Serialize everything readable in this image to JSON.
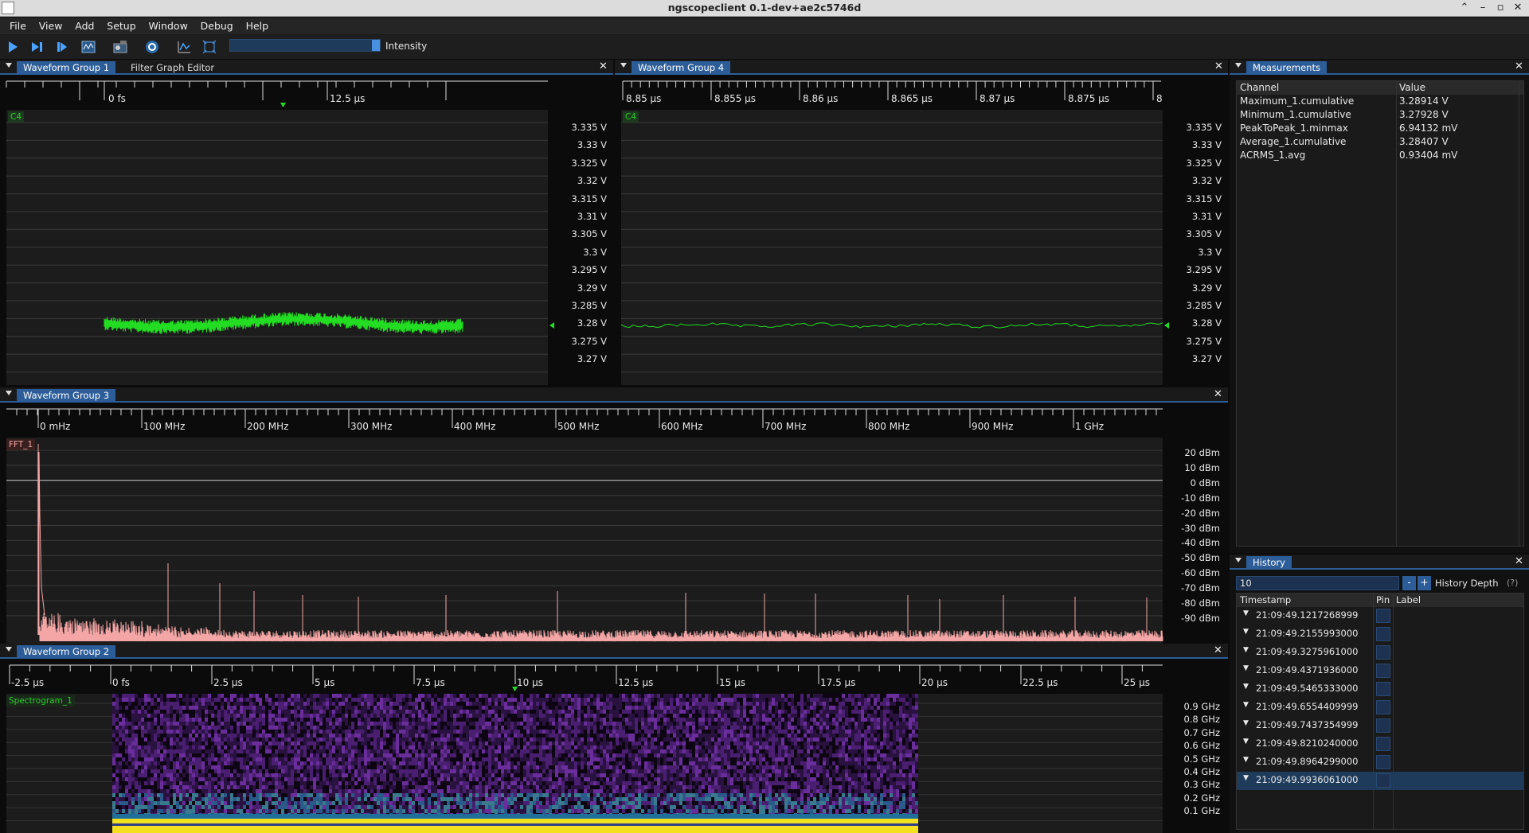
{
  "window": {
    "title": "ngscopeclient 0.1-dev+ae2c5746d"
  },
  "menu": [
    "File",
    "View",
    "Add",
    "Setup",
    "Window",
    "Debug",
    "Help"
  ],
  "toolbar": {
    "icons": [
      "play-icon",
      "step-icon",
      "single-trigger-icon",
      "waveform-icon",
      "instrument-icon",
      "settings-icon",
      "measure-icon",
      "fit-icon"
    ],
    "intensity_label": "Intensity"
  },
  "group1": {
    "tabs": [
      "Waveform Group 1",
      "Filter Graph Editor"
    ],
    "x_ticks": [
      "0 fs",
      "12.5 µs"
    ],
    "channel": "C4",
    "y_ticks": [
      "3.335 V",
      "3.33 V",
      "3.325 V",
      "3.32 V",
      "3.315 V",
      "3.31 V",
      "3.305 V",
      "3.3 V",
      "3.295 V",
      "3.29 V",
      "3.285 V",
      "3.28 V",
      "3.275 V",
      "3.27 V"
    ]
  },
  "group4": {
    "tab": "Waveform Group 4",
    "x_ticks": [
      "8.85 µs",
      "8.855 µs",
      "8.86 µs",
      "8.865 µs",
      "8.87 µs",
      "8.875 µs",
      "8"
    ],
    "channel": "C4",
    "y_ticks": [
      "3.335 V",
      "3.33 V",
      "3.325 V",
      "3.32 V",
      "3.315 V",
      "3.31 V",
      "3.305 V",
      "3.3 V",
      "3.295 V",
      "3.29 V",
      "3.285 V",
      "3.28 V",
      "3.275 V",
      "3.27 V"
    ]
  },
  "group3": {
    "tab": "Waveform Group 3",
    "x_ticks": [
      "0 mHz",
      "100 MHz",
      "200 MHz",
      "300 MHz",
      "400 MHz",
      "500 MHz",
      "600 MHz",
      "700 MHz",
      "800 MHz",
      "900 MHz",
      "1 GHz"
    ],
    "channel": "FFT_1",
    "y_ticks": [
      "20 dBm",
      "10 dBm",
      "0 dBm",
      "-10 dBm",
      "-20 dBm",
      "-30 dBm",
      "-40 dBm",
      "-50 dBm",
      "-60 dBm",
      "-70 dBm",
      "-80 dBm",
      "-90 dBm"
    ]
  },
  "group2": {
    "tab": "Waveform Group 2",
    "x_ticks": [
      "-2.5 µs",
      "0 fs",
      "2.5 µs",
      "5 µs",
      "7.5 µs",
      "10 µs",
      "12.5 µs",
      "15 µs",
      "17.5 µs",
      "20 µs",
      "22.5 µs",
      "25 µs"
    ],
    "channel": "Spectrogram_1",
    "y_ticks": [
      "0.9 GHz",
      "0.8 GHz",
      "0.7 GHz",
      "0.6 GHz",
      "0.5 GHz",
      "0.4 GHz",
      "0.3 GHz",
      "0.2 GHz",
      "0.1 GHz"
    ]
  },
  "measurements": {
    "tab": "Measurements",
    "headers": [
      "Channel",
      "Value"
    ],
    "rows": [
      [
        "Maximum_1.cumulative",
        "3.28914 V"
      ],
      [
        "Minimum_1.cumulative",
        "3.27928 V"
      ],
      [
        "PeakToPeak_1.minmax",
        "6.94132 mV"
      ],
      [
        "Average_1.cumulative",
        "3.28407 V"
      ],
      [
        "ACRMS_1.avg",
        "0.93404 mV"
      ]
    ]
  },
  "history": {
    "tab": "History",
    "depth_value": "10",
    "minus": "-",
    "plus": "+",
    "depth_label": "History Depth",
    "help": "(?)",
    "headers": [
      "Timestamp",
      "Pin",
      "Label"
    ],
    "rows": [
      "21:09:49.1217268999",
      "21:09:49.2155993000",
      "21:09:49.3275961000",
      "21:09:49.4371936000",
      "21:09:49.5465333000",
      "21:09:49.6554409999",
      "21:09:49.7437354999",
      "21:09:49.8210240000",
      "21:09:49.8964299000",
      "21:09:49.9936061000"
    ],
    "selected_index": 9
  },
  "colors": {
    "accent": "#2c5d99",
    "trace_green": "#22dd22",
    "fft_pink": "#f4a6a6",
    "spectro_purple": "#5b2a86",
    "spectro_yellow": "#f5e020"
  }
}
